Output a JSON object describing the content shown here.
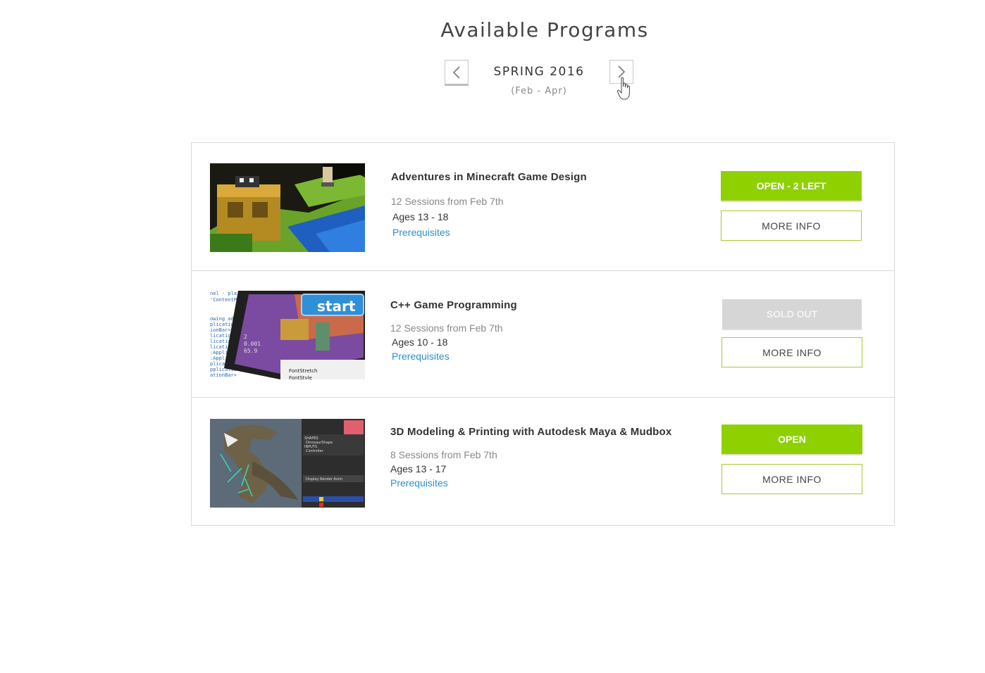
{
  "page": {
    "title": "Available Programs"
  },
  "term": {
    "name": "SPRING 2016",
    "range": "(Feb - Apr)",
    "prev_icon": "chevron-left-icon",
    "next_icon": "chevron-right-icon",
    "cursor_icon": "pointer-hand-icon"
  },
  "colors": {
    "accent_green": "#8fd100",
    "sold_out_gray": "#d6d6d6",
    "link_blue": "#2a8fd0",
    "outline_green": "#a6cc2c"
  },
  "programs": [
    {
      "title": "Adventures in Minecraft Game Design",
      "sessions": "12 Sessions from Feb 7th",
      "ages": "Ages 13 - 18",
      "prereq_label": "Prerequisites",
      "status_label": "OPEN - 2 LEFT",
      "status": "open",
      "more_info_label": "MORE INFO",
      "thumbnail": "minecraft-scene-image"
    },
    {
      "title": "C++ Game Programming",
      "sessions": "12 Sessions from Feb 7th",
      "ages": "Ages 10 - 18",
      "prereq_label": "Prerequisites",
      "status_label": "SOLD OUT",
      "status": "sold-out",
      "more_info_label": "MORE INFO",
      "thumbnail": "game-code-tablet-image"
    },
    {
      "title": "3D Modeling & Printing with Autodesk Maya & Mudbox",
      "sessions": "8 Sessions from Feb 7th",
      "ages": "Ages 13 - 17",
      "prereq_label": "Prerequisites",
      "status_label": "OPEN",
      "status": "open",
      "more_info_label": "MORE INFO",
      "thumbnail": "dinosaur-3d-model-image"
    }
  ]
}
